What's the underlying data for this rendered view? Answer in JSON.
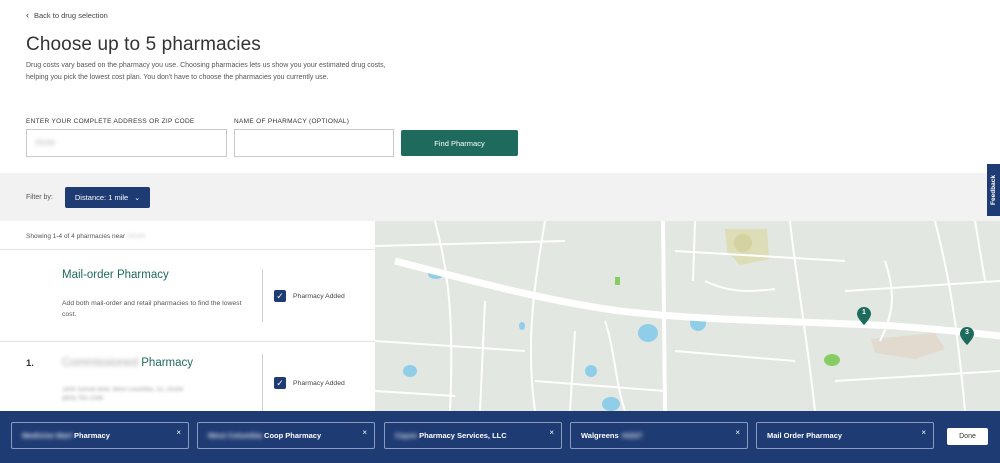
{
  "nav": {
    "back_label": "Back to drug selection"
  },
  "header": {
    "title": "Choose up to 5 pharmacies",
    "description": "Drug costs vary based on the pharmacy you use. Choosing pharmacies lets us show you your estimated drug costs, helping you pick the lowest cost plan. You don't have to choose the pharmacies you currently use."
  },
  "search": {
    "address_label": "ENTER YOUR COMPLETE ADDRESS OR ZIP CODE",
    "address_value": "29169",
    "pharmacy_label": "NAME OF PHARMACY (OPTIONAL)",
    "pharmacy_value": "",
    "find_button": "Find Pharmacy"
  },
  "filter": {
    "label": "Filter by:",
    "distance": "Distance: 1 mile"
  },
  "feedback": {
    "label": "Feedback"
  },
  "results": {
    "showing_prefix": "Showing 1-4 of 4 pharmacies near",
    "showing_zip": "29169",
    "mail_order": {
      "title": "Mail-order Pharmacy",
      "description": "Add both mail-order and retail pharmacies to find the lowest cost.",
      "status": "Pharmacy Added"
    },
    "first": {
      "number": "1.",
      "name_blurred": "Commissioned",
      "name_suffix": "Pharmacy",
      "address_line1": "1806 Sunset Blvd, West Columbia, SC 29169",
      "address_line2": "(803) 791-1046",
      "status": "Pharmacy Added"
    }
  },
  "map": {
    "markers": [
      {
        "label": "1"
      },
      {
        "label": "3"
      }
    ]
  },
  "tray": {
    "chips": [
      {
        "blurred": "Medicine Mart",
        "name": "Pharmacy",
        "close": "×"
      },
      {
        "blurred": "West Columbia",
        "name": "Coop Pharmacy",
        "close": "×"
      },
      {
        "blurred": "Cayce",
        "name": "Pharmacy Services, LLC",
        "close": "×"
      },
      {
        "blurred": "",
        "name": "Walgreens",
        "blurred_after": "#2227",
        "close": "×"
      },
      {
        "blurred": "",
        "name": "Mail Order Pharmacy",
        "close": "×"
      }
    ],
    "done": "Done"
  },
  "colors": {
    "primary_green": "#1e6b5d",
    "navy": "#1f3b73",
    "filter_bg": "#f2f2f2"
  }
}
